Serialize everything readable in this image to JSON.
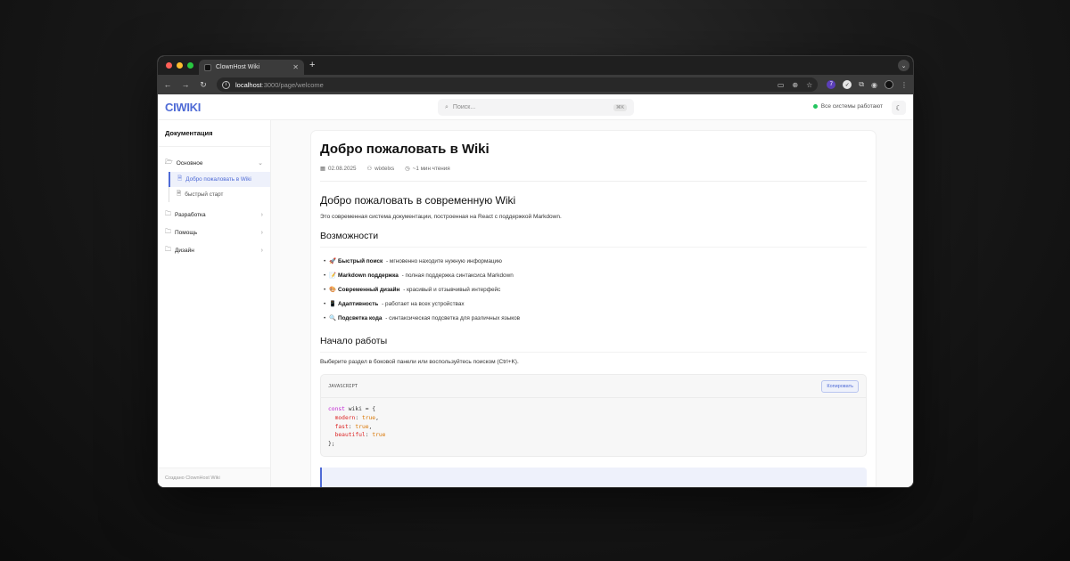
{
  "browser": {
    "tab_title": "ClownHost Wiki",
    "new_tab": "+",
    "url_host": "localhost",
    "url_path": ":3000/page/welcome",
    "traffic_colors": [
      "#ff5f57",
      "#febc2e",
      "#28c840"
    ]
  },
  "app": {
    "logo": "CIWIKI",
    "search_placeholder": "Поиск...",
    "search_shortcut": "⌘K",
    "status": "Все системы работают",
    "accent": "#4f6bd6"
  },
  "sidebar": {
    "title": "Документация",
    "groups": [
      {
        "label": "Основное",
        "expanded": true,
        "items": [
          "Добро пожаловать в Wiki",
          "быстрый старт"
        ]
      },
      {
        "label": "Разработка",
        "expanded": false
      },
      {
        "label": "Помощь",
        "expanded": false
      },
      {
        "label": "Дизайн",
        "expanded": false
      }
    ],
    "footer": "Создано ClownHost Wiki"
  },
  "article": {
    "title": "Добро пожаловать в Wiki",
    "date": "02.08.2025",
    "author": "wixtelxs",
    "read_time": "~1 мин чтения",
    "h2": "Добро пожаловать в современную Wiki",
    "intro": "Это современная система документации, построенная на React с поддержкой Markdown.",
    "features_title": "Возможности",
    "features": [
      {
        "emoji": "🚀",
        "bold": "Быстрый поиск",
        "text": "- мгновенно находите нужную информацию"
      },
      {
        "emoji": "📝",
        "bold": "Markdown поддержка",
        "text": "- полная поддержка синтаксиса Markdown"
      },
      {
        "emoji": "🎨",
        "bold": "Современный дизайн",
        "text": "- красивый и отзывчивый интерфейс"
      },
      {
        "emoji": "📱",
        "bold": "Адаптивность",
        "text": "- работает на всех устройствах"
      },
      {
        "emoji": "🔍",
        "bold": "Подсветка кода",
        "text": "- синтаксическая подсветка для различных языков"
      }
    ],
    "start_title": "Начало работы",
    "start_text": "Выберите раздел в боковой панели или воспользуйтесь поиском (Ctrl+K).",
    "code_lang": "JAVASCRIPT",
    "copy_label": "Копировать"
  }
}
